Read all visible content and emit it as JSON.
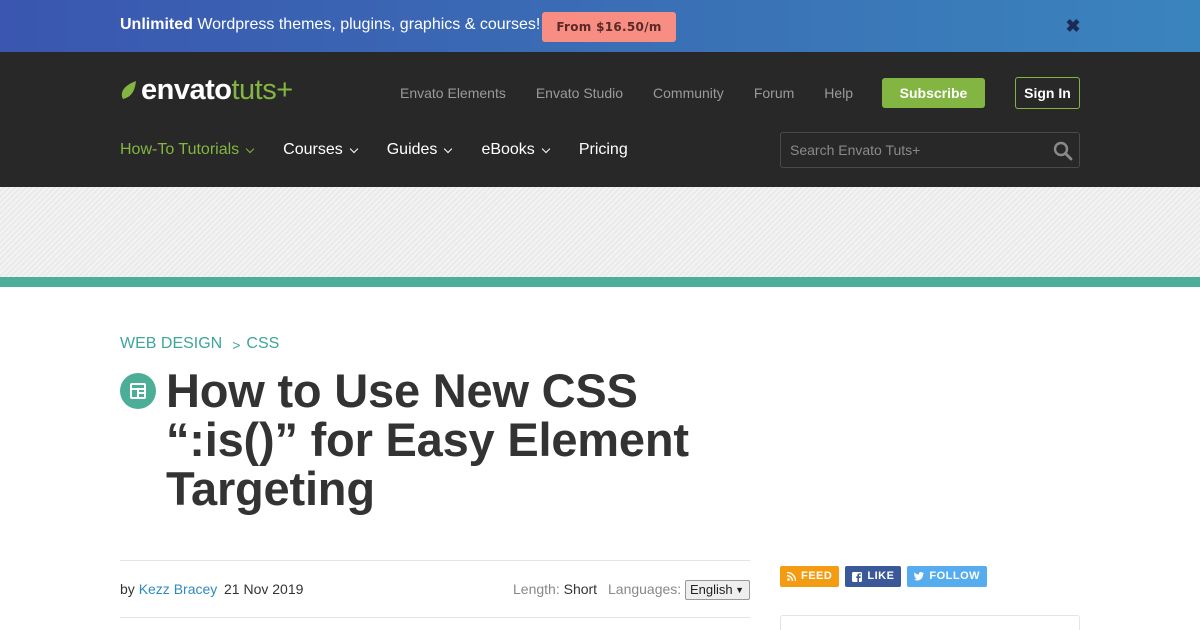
{
  "promo": {
    "strong": "Unlimited",
    "text": " Wordpress themes, plugins, graphics & courses!",
    "cta": "From $16.50/m",
    "close_icon": "close-icon"
  },
  "header": {
    "logo_envato": "envato",
    "logo_tuts": "tuts+",
    "top_links": [
      "Envato Elements",
      "Envato Studio",
      "Community",
      "Forum",
      "Help"
    ],
    "subscribe": "Subscribe",
    "signin": "Sign In",
    "nav": [
      {
        "label": "How-To Tutorials",
        "dropdown": true,
        "active": true
      },
      {
        "label": "Courses",
        "dropdown": true
      },
      {
        "label": "Guides",
        "dropdown": true
      },
      {
        "label": "eBooks",
        "dropdown": true
      },
      {
        "label": "Pricing",
        "dropdown": false
      }
    ],
    "search_placeholder": "Search Envato Tuts+"
  },
  "article": {
    "breadcrumb": {
      "category": "WEB DESIGN",
      "separator": ">",
      "subcategory": "CSS"
    },
    "title": "How to Use New CSS “:is()” for Easy Element Targeting",
    "by": "by",
    "author": "Kezz Bracey",
    "date": "21 Nov 2019",
    "length_label": "Length:",
    "length_value": "Short",
    "languages_label": "Languages:",
    "language_selected": "English",
    "language_arrow": "▼"
  },
  "social": {
    "feed": "FEED",
    "like": "LIKE",
    "follow": "FOLLOW"
  },
  "colors": {
    "accent_green": "#82b541",
    "teal": "#4cae96",
    "header_bg": "#282828",
    "promo_btn": "#f88d83"
  }
}
